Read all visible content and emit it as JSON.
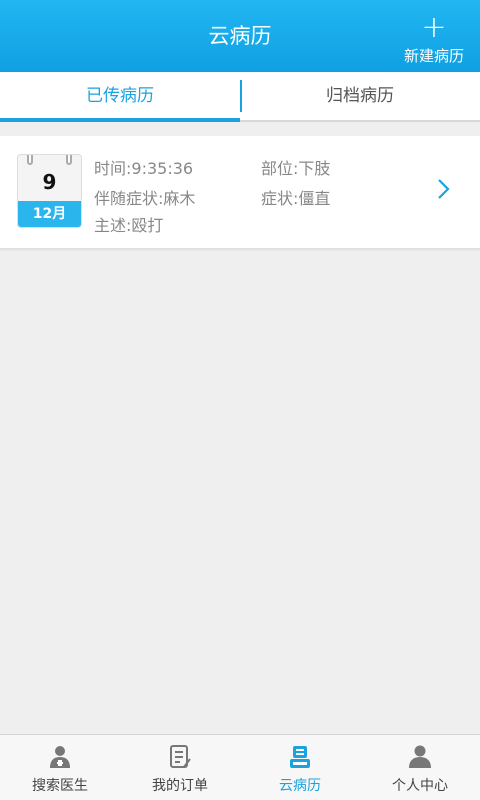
{
  "header": {
    "title": "云病历",
    "new_label": "新建病历"
  },
  "tabs": [
    {
      "label": "已传病历"
    },
    {
      "label": "归档病历"
    }
  ],
  "record": {
    "day": "9",
    "month": "12月",
    "time": "时间:9:35:36",
    "site": "部位:下肢",
    "accompanying": "伴随症状:麻木",
    "symptom": "症状:僵直",
    "complaint": "主述:殴打"
  },
  "bottom_nav": [
    {
      "label": "搜索医生",
      "icon": "doctor-icon"
    },
    {
      "label": "我的订单",
      "icon": "order-icon"
    },
    {
      "label": "云病历",
      "icon": "record-icon"
    },
    {
      "label": "个人中心",
      "icon": "person-icon"
    }
  ],
  "colors": {
    "accent": "#1aa3e0",
    "header": "#17a9ea",
    "background": "#efefef"
  }
}
